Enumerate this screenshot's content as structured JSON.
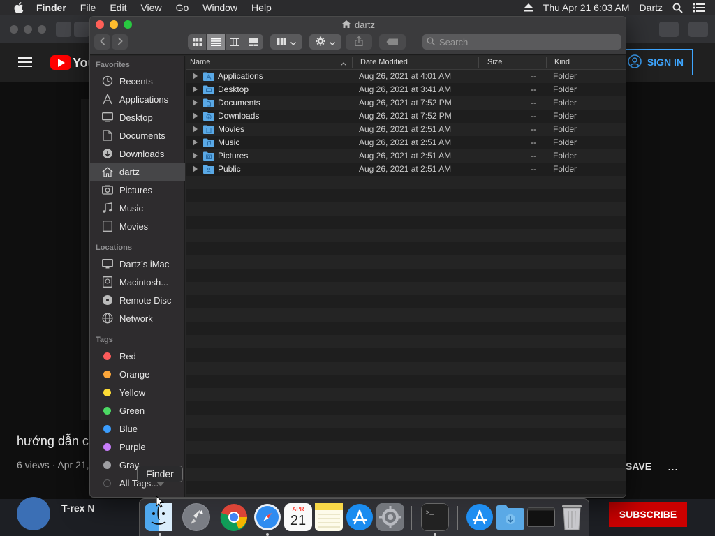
{
  "menubar": {
    "app_name": "Finder",
    "menus": [
      "File",
      "Edit",
      "View",
      "Go",
      "Window",
      "Help"
    ],
    "datetime": "Thu Apr 21  6:03 AM",
    "user": "Dartz"
  },
  "background_browser": {
    "logo_text": "You",
    "signin_label": "SIGN IN",
    "video_title": "hướng dẫn ch",
    "video_meta": "6 views · Apr 21,",
    "save_label": "SAVE",
    "more_label": "...",
    "channel_name": "T-rex N",
    "subscribe_label": "SUBSCRIBE"
  },
  "finder": {
    "window_title": "dartz",
    "search_placeholder": "Search",
    "sidebar": {
      "favorites_heading": "Favorites",
      "favorites": [
        {
          "label": "Recents",
          "icon": "recents-icon"
        },
        {
          "label": "Applications",
          "icon": "applications-icon"
        },
        {
          "label": "Desktop",
          "icon": "desktop-icon"
        },
        {
          "label": "Documents",
          "icon": "documents-icon"
        },
        {
          "label": "Downloads",
          "icon": "downloads-icon"
        },
        {
          "label": "dartz",
          "icon": "home-icon",
          "selected": true
        },
        {
          "label": "Pictures",
          "icon": "pictures-icon"
        },
        {
          "label": "Music",
          "icon": "music-icon"
        },
        {
          "label": "Movies",
          "icon": "movies-icon"
        }
      ],
      "locations_heading": "Locations",
      "locations": [
        {
          "label": "Dartz’s iMac",
          "icon": "imac-icon"
        },
        {
          "label": "Macintosh...",
          "icon": "hard-drive-icon"
        },
        {
          "label": "Remote Disc",
          "icon": "disc-icon"
        },
        {
          "label": "Network",
          "icon": "network-icon"
        }
      ],
      "tags_heading": "Tags",
      "tags": [
        {
          "label": "Red",
          "color": "#fc5b5b"
        },
        {
          "label": "Orange",
          "color": "#fca63a"
        },
        {
          "label": "Yellow",
          "color": "#fddc35"
        },
        {
          "label": "Green",
          "color": "#4cd964"
        },
        {
          "label": "Blue",
          "color": "#3b9dfd"
        },
        {
          "label": "Purple",
          "color": "#c77dfa"
        },
        {
          "label": "Gray",
          "color": "#9e9ea2"
        },
        {
          "label": "All Tags...",
          "color": "#5e5e60"
        }
      ]
    },
    "columns": {
      "name": "Name",
      "date": "Date Modified",
      "size": "Size",
      "kind": "Kind"
    },
    "files": [
      {
        "name": "Applications",
        "date": "Aug 26, 2021 at 4:01 AM",
        "size": "--",
        "kind": "Folder"
      },
      {
        "name": "Desktop",
        "date": "Aug 26, 2021 at 3:41 AM",
        "size": "--",
        "kind": "Folder"
      },
      {
        "name": "Documents",
        "date": "Aug 26, 2021 at 7:52 PM",
        "size": "--",
        "kind": "Folder"
      },
      {
        "name": "Downloads",
        "date": "Aug 26, 2021 at 7:52 PM",
        "size": "--",
        "kind": "Folder"
      },
      {
        "name": "Movies",
        "date": "Aug 26, 2021 at 2:51 AM",
        "size": "--",
        "kind": "Folder"
      },
      {
        "name": "Music",
        "date": "Aug 26, 2021 at 2:51 AM",
        "size": "--",
        "kind": "Folder"
      },
      {
        "name": "Pictures",
        "date": "Aug 26, 2021 at 2:51 AM",
        "size": "--",
        "kind": "Folder"
      },
      {
        "name": "Public",
        "date": "Aug 26, 2021 at 2:51 AM",
        "size": "--",
        "kind": "Folder"
      }
    ]
  },
  "dock": {
    "tooltip": "Finder",
    "calendar_month": "APR",
    "calendar_day": "21",
    "apps": [
      "finder-icon",
      "launchpad-icon",
      "chrome-icon",
      "safari-icon",
      "calendar-icon",
      "notes-icon",
      "app-store-icon",
      "system-preferences-icon",
      "terminal-icon",
      "applications-folder-icon",
      "downloads-folder-icon",
      "screen-window-icon",
      "trash-icon"
    ]
  },
  "colors": {
    "folder_blue": "#5aa9e6",
    "selection": "#464648",
    "youtube_red": "#ff0000",
    "signin_blue": "#3ea6ff"
  }
}
